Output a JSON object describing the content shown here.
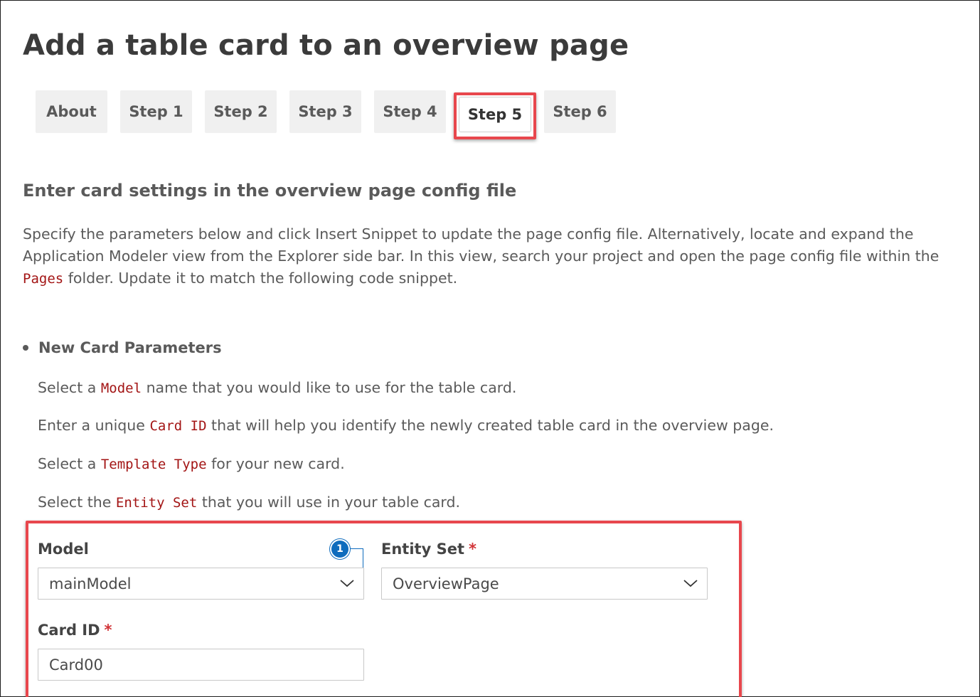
{
  "page": {
    "title": "Add a table card to an overview page"
  },
  "tabs": [
    {
      "label": "About",
      "active": false
    },
    {
      "label": "Step 1",
      "active": false
    },
    {
      "label": "Step 2",
      "active": false
    },
    {
      "label": "Step 3",
      "active": false
    },
    {
      "label": "Step 4",
      "active": false
    },
    {
      "label": "Step 5",
      "active": true
    },
    {
      "label": "Step 6",
      "active": false
    }
  ],
  "section": {
    "heading": "Enter card settings in the overview page config file",
    "desc_part1": "Specify the parameters below and click Insert Snippet to update the page config file. Alternatively, locate and expand the Application Modeler view from the Explorer side bar. In this view, search your project and open the page config file within the ",
    "desc_code": "Pages",
    "desc_part2": " folder. Update it to match the following code snippet."
  },
  "parameters": {
    "heading": "New Card Parameters",
    "lines": [
      {
        "before": "Select a ",
        "code": "Model",
        "after": " name that you would like to use for the table card."
      },
      {
        "before": "Enter a unique ",
        "code": "Card ID",
        "after": " that will help you identify the newly created table card in the overview page."
      },
      {
        "before": "Select a ",
        "code": "Template Type",
        "after": " for your new card."
      },
      {
        "before": "Select the ",
        "code": "Entity Set",
        "after": " that you will use in your table card."
      }
    ]
  },
  "form": {
    "model_label": "Model",
    "model_value": "mainModel",
    "entity_label": "Entity Set",
    "entity_value": "OverviewPage",
    "cardid_label": "Card ID",
    "cardid_value": "Card00",
    "required_mark": "*",
    "badge_number": "1",
    "chevron_icon": "chevron-down-icon"
  },
  "colors": {
    "highlight": "#e8474d",
    "code": "#a31515",
    "required": "#d13438",
    "badge": "#0f6cbd",
    "tab_bg": "#f0f0f0"
  }
}
